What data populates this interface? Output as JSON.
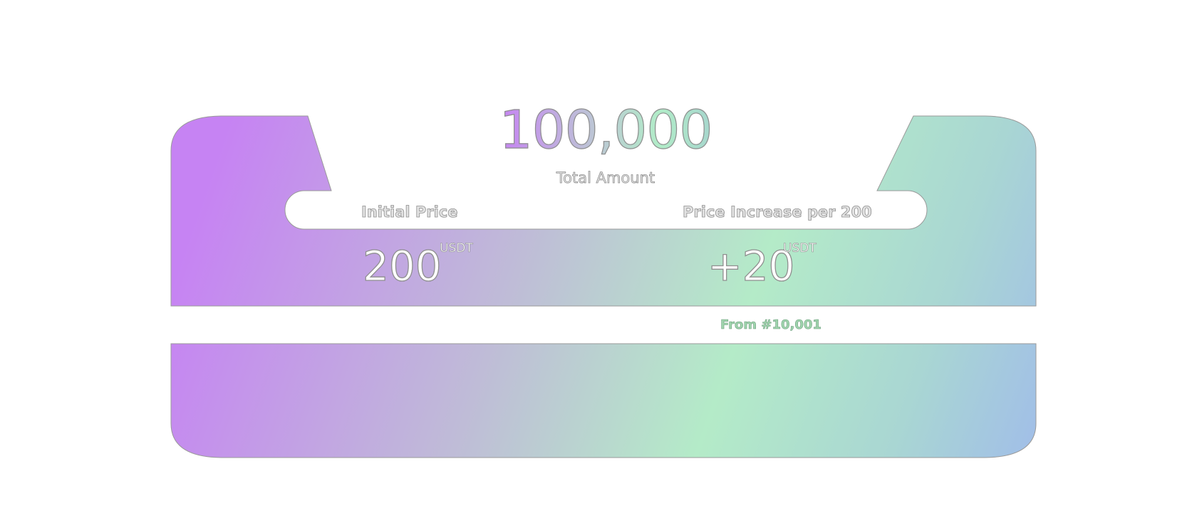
{
  "total": {
    "amount": "100,000",
    "label": "Total Amount"
  },
  "pricing": {
    "initial": {
      "label": "Initial Price",
      "value": "200",
      "unit": "USDT"
    },
    "increase": {
      "label": "Price Increase per 200",
      "value": "+20",
      "unit": "USDT",
      "note": "From #10,001"
    }
  },
  "colors": {
    "gradient_start": "#c683f3",
    "gradient_mid": "#b4ebc8",
    "gradient_end": "#a1bee8",
    "outline": "#8f8f8f",
    "note_green": "#9fd4ad"
  }
}
